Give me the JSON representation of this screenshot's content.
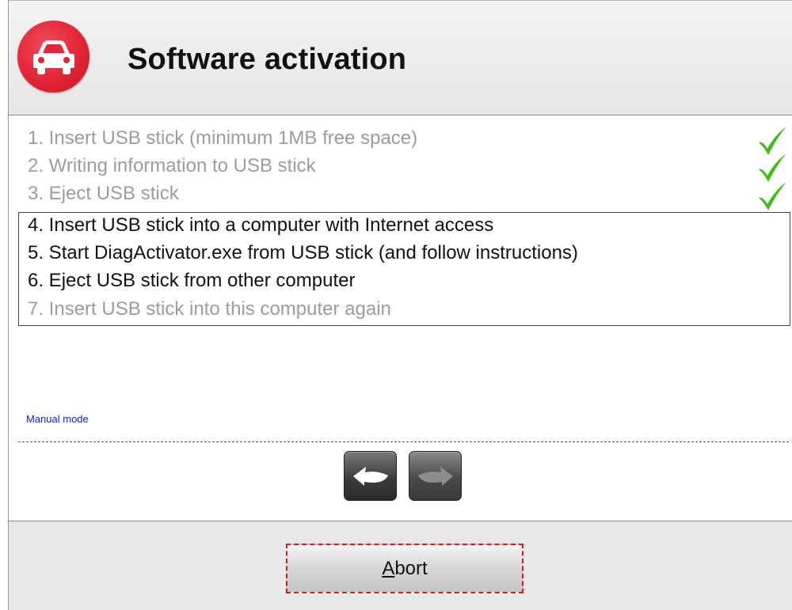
{
  "header": {
    "title": "Software activation",
    "icon": "car-icon",
    "badge_color": "#e22537"
  },
  "steps": [
    {
      "label": "1. Insert USB stick (minimum 1MB free space)",
      "status": "done"
    },
    {
      "label": "2. Writing information to USB stick",
      "status": "done"
    },
    {
      "label": "3. Eject USB stick",
      "status": "done"
    },
    {
      "label": "4. Insert USB stick into a computer with Internet access",
      "status": "active"
    },
    {
      "label": "5. Start DiagActivator.exe from USB stick (and follow instructions)",
      "status": "active"
    },
    {
      "label": "6. Eject USB stick from other computer",
      "status": "active"
    },
    {
      "label": "7. Insert USB stick into this computer again",
      "status": "pending"
    }
  ],
  "check_icon": "checkmark-icon",
  "check_color": "#2db400",
  "manual_mode_label": "Manual mode",
  "nav": {
    "back_icon": "back-arrow-icon",
    "forward_icon": "forward-arrow-icon"
  },
  "footer": {
    "abort_accesskey": "A",
    "abort_rest": "bort"
  }
}
